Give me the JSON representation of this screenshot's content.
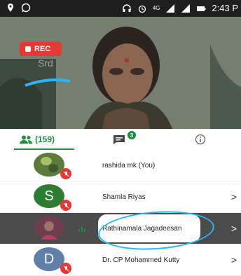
{
  "status_bar": {
    "time": "2:43 P",
    "signal_label": "4G"
  },
  "video": {
    "rec_label": "REC",
    "wall_text": "Srd"
  },
  "tabs": {
    "people_count": "(159)",
    "chat_badge": "3"
  },
  "participants": [
    {
      "name": "rashida mk (You)",
      "avatar_letter": "",
      "avatar_color": "#6b8c4a",
      "muted": true,
      "speaking": false,
      "chevron": ""
    },
    {
      "name": "Shamla Riyas",
      "avatar_letter": "S",
      "avatar_color": "#2e7d32",
      "muted": true,
      "speaking": false,
      "chevron": ">"
    },
    {
      "name": "Rathinamala Jagadeesan",
      "avatar_letter": "",
      "avatar_color": "#7a4a5a",
      "muted": false,
      "speaking": true,
      "chevron": ">"
    },
    {
      "name": "Dr. CP Mohammed Kutty",
      "avatar_letter": "D",
      "avatar_color": "#5f7fa8",
      "muted": true,
      "speaking": false,
      "chevron": ">"
    }
  ],
  "colors": {
    "accent": "#1e8e3e",
    "rec": "#e53935",
    "annotation": "#29b6f6"
  }
}
